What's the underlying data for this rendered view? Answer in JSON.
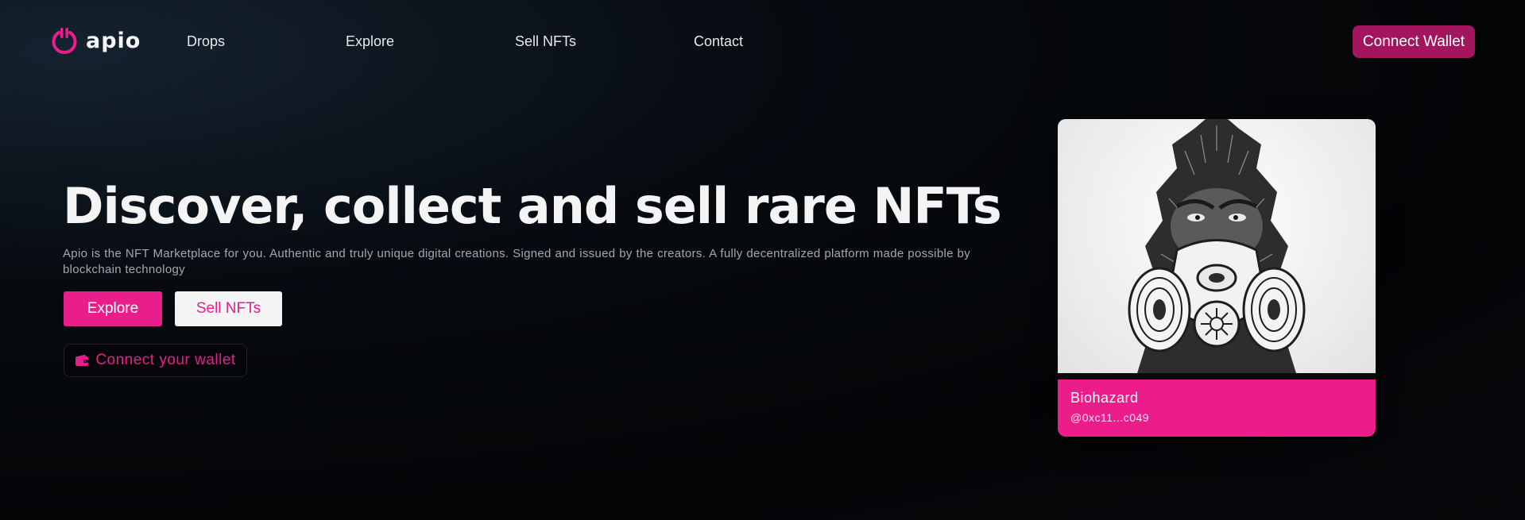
{
  "brand": {
    "name": "apio",
    "icon": "power-icon",
    "accent": "#e91e8c"
  },
  "nav": {
    "items": [
      {
        "label": "Drops"
      },
      {
        "label": "Explore"
      },
      {
        "label": "Sell NFTs"
      },
      {
        "label": "Contact"
      }
    ],
    "connect_label": "Connect Wallet"
  },
  "hero": {
    "title": "Discover, collect and sell rare NFTs",
    "description": "Apio is the NFT Marketplace for you. Authentic and truly unique digital creations. Signed and issued by the creators. A fully decentralized platform made possible by blockchain technology",
    "explore_label": "Explore",
    "sell_label": "Sell NFTs",
    "wallet_label": "Connect your wallet",
    "wallet_icon": "wallet-icon"
  },
  "featured": {
    "name": "Biohazard",
    "owner": "@0xc11...c049",
    "image": "gorilla-gas-mask-artwork"
  }
}
